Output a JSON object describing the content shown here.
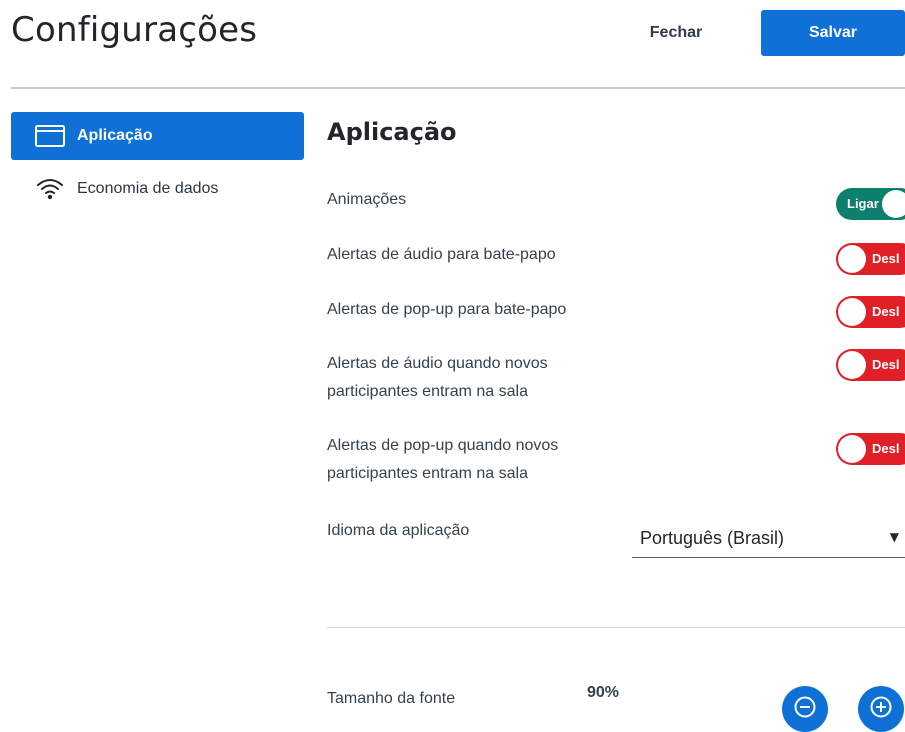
{
  "header": {
    "title": "Configurações",
    "close_label": "Fechar",
    "save_label": "Salvar"
  },
  "sidebar": {
    "items": [
      {
        "label": "Aplicação",
        "icon": "window-icon",
        "active": true
      },
      {
        "label": "Economia de dados",
        "icon": "wifi-icon",
        "active": false
      }
    ]
  },
  "main": {
    "section_title": "Aplicação",
    "settings": [
      {
        "label": "Animações",
        "state": "on",
        "toggle_text": "Ligar"
      },
      {
        "label": "Alertas de áudio para bate-papo",
        "state": "off",
        "toggle_text": "Desl"
      },
      {
        "label": "Alertas de pop-up para bate-papo",
        "state": "off",
        "toggle_text": "Desl"
      },
      {
        "label": "Alertas de áudio quando novos participantes entram na sala",
        "state": "off",
        "toggle_text": "Desl"
      },
      {
        "label": "Alertas de pop-up quando novos participantes entram na sala",
        "state": "off",
        "toggle_text": "Desl"
      }
    ],
    "language": {
      "label": "Idioma da aplicação",
      "selected": "Português (Brasil)"
    },
    "font_size": {
      "label": "Tamanho da fonte",
      "value": "90%"
    }
  },
  "colors": {
    "primary": "#0f70d7",
    "toggle_on": "#0c7f6d",
    "toggle_off": "#e11f27"
  }
}
